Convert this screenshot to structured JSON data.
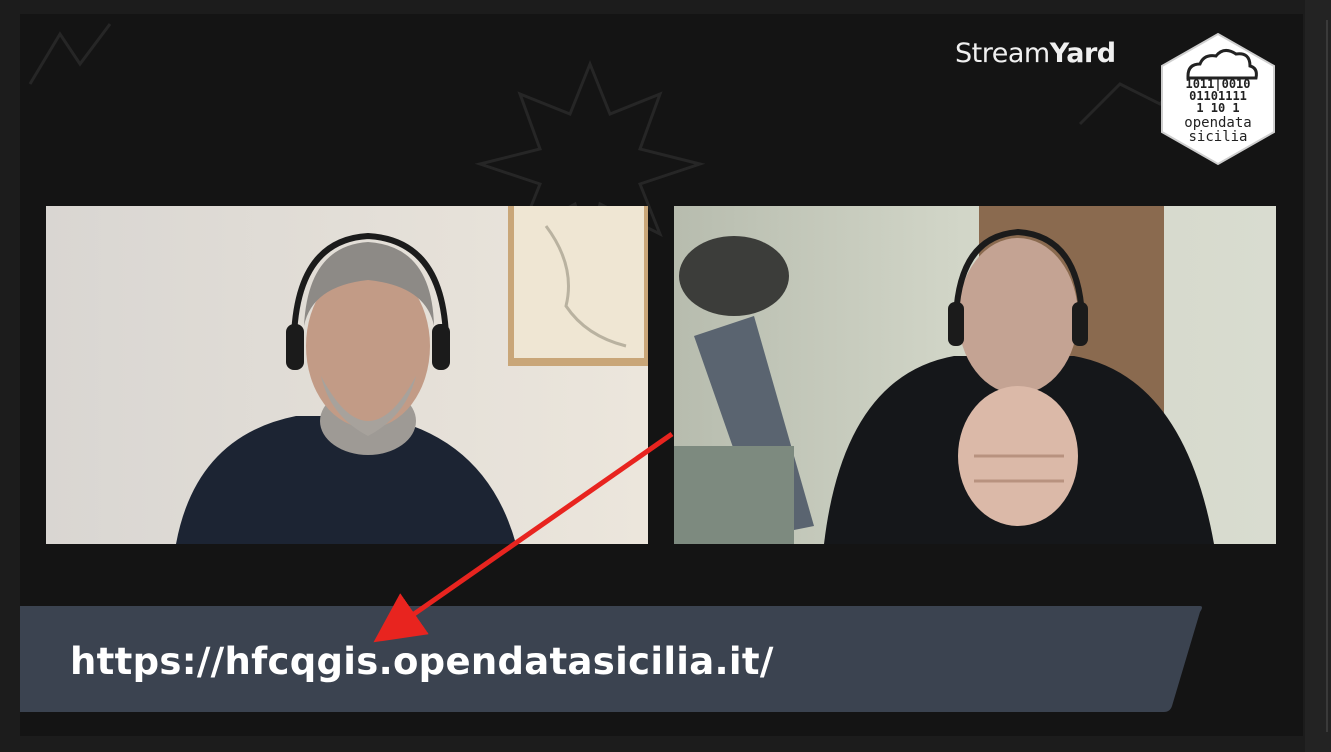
{
  "brand": {
    "name_regular": "Stream",
    "name_bold": "Yard"
  },
  "logo": {
    "icon": "cloud-binary-hexagon-icon",
    "binary_lines": [
      "1011|0010",
      "01101111",
      "1 10 1"
    ],
    "line1": "opendata",
    "line2": "sicilia"
  },
  "participants": [
    {
      "icon": "participant-video-icon"
    },
    {
      "icon": "participant-video-icon"
    }
  ],
  "banner": {
    "url_text": "https://hfcqgis.opendatasicilia.it/"
  },
  "colors": {
    "banner_bg": "#3b4350",
    "arrow": "#e8241f",
    "stage_bg": "#141414"
  }
}
